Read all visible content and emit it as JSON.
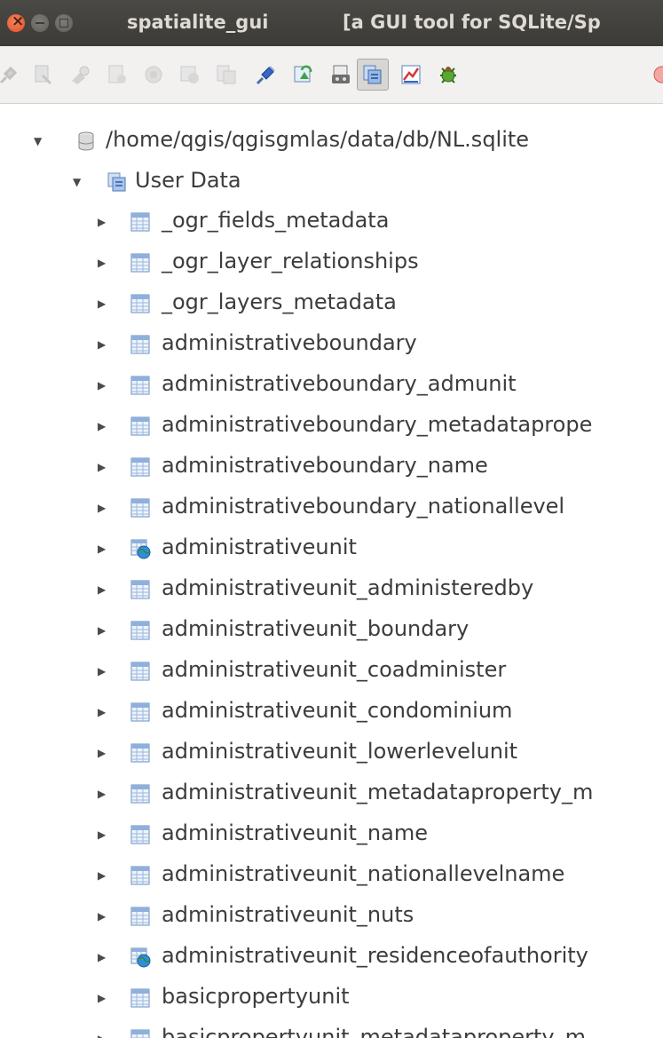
{
  "window": {
    "app_title": "spatialite_gui",
    "description": "[a GUI tool for SQLite/Sp"
  },
  "toolbar": {
    "buttons": [
      {
        "icon": "connect-icon",
        "state": "disabled"
      },
      {
        "icon": "disconnect-icon",
        "state": "disabled"
      },
      {
        "icon": "vacuum-icon",
        "state": "disabled"
      },
      {
        "icon": "sql-script-icon",
        "state": "disabled"
      },
      {
        "icon": "load-shapefile-icon",
        "state": "disabled"
      },
      {
        "icon": "virtual-shapefile-icon",
        "state": "disabled"
      },
      {
        "icon": "virtual-csv-icon",
        "state": "disabled"
      },
      {
        "icon": "attach-db-icon",
        "state": "enabled"
      },
      {
        "icon": "query-table-composer-icon",
        "state": "enabled"
      },
      {
        "icon": "save-icon",
        "state": "enabled"
      },
      {
        "icon": "memory-db-icon",
        "state": "pressed"
      },
      {
        "icon": "charts-icon",
        "state": "enabled"
      },
      {
        "icon": "check-geometries-icon",
        "state": "enabled"
      },
      {
        "icon": "help-icon",
        "state": "enabled"
      }
    ]
  },
  "tree": {
    "root": {
      "label": "/home/qgis/qgisgmlas/data/db/NL.sqlite",
      "icon": "database-icon",
      "expanded": true
    },
    "group": {
      "label": "User Data",
      "icon": "user-data-icon",
      "expanded": true
    },
    "items": [
      {
        "label": "_ogr_fields_metadata",
        "icon": "table-icon"
      },
      {
        "label": "_ogr_layer_relationships",
        "icon": "table-icon"
      },
      {
        "label": "_ogr_layers_metadata",
        "icon": "table-icon"
      },
      {
        "label": "administrativeboundary",
        "icon": "table-icon"
      },
      {
        "label": "administrativeboundary_admunit",
        "icon": "table-icon"
      },
      {
        "label": "administrativeboundary_metadataprope",
        "icon": "table-icon"
      },
      {
        "label": "administrativeboundary_name",
        "icon": "table-icon"
      },
      {
        "label": "administrativeboundary_nationallevel",
        "icon": "table-icon"
      },
      {
        "label": "administrativeunit",
        "icon": "geometry-table-icon"
      },
      {
        "label": "administrativeunit_administeredby",
        "icon": "table-icon"
      },
      {
        "label": "administrativeunit_boundary",
        "icon": "table-icon"
      },
      {
        "label": "administrativeunit_coadminister",
        "icon": "table-icon"
      },
      {
        "label": "administrativeunit_condominium",
        "icon": "table-icon"
      },
      {
        "label": "administrativeunit_lowerlevelunit",
        "icon": "table-icon"
      },
      {
        "label": "administrativeunit_metadataproperty_m",
        "icon": "table-icon"
      },
      {
        "label": "administrativeunit_name",
        "icon": "table-icon"
      },
      {
        "label": "administrativeunit_nationallevelname",
        "icon": "table-icon"
      },
      {
        "label": "administrativeunit_nuts",
        "icon": "table-icon"
      },
      {
        "label": "administrativeunit_residenceofauthority",
        "icon": "geometry-table-icon"
      },
      {
        "label": "basicpropertyunit",
        "icon": "table-icon"
      },
      {
        "label": "basicpropertyunit_metadataproperty_m",
        "icon": "table-icon"
      }
    ]
  }
}
